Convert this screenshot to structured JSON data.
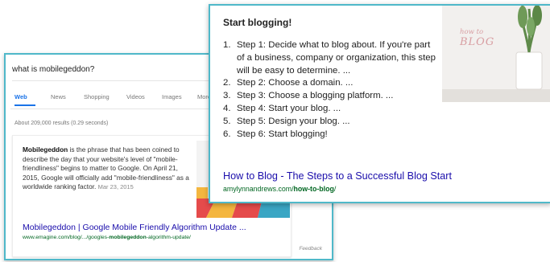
{
  "search_result": {
    "query": "what is mobilegeddon?",
    "tabs": [
      "Web",
      "News",
      "Shopping",
      "Videos",
      "Images",
      "More"
    ],
    "results_stats": "About 209,000 results (0.29 seconds)",
    "snippet": {
      "term": "Mobilegeddon",
      "text": " is the phrase that has been coined to describe the day that your website's level of \"mobile-friendliness\" begins to matter to Google. On April 21, 2015, Google will officially add \"mobile-friendliness\" as a worldwide ranking factor.",
      "date": "Mar 23, 2015",
      "title": "Mobilegeddon | Google Mobile Friendly Algorithm Update ...",
      "url_prefix": "www.emagine.com/blog/.../googles-",
      "url_bold": "mobilegeddon",
      "url_suffix": "-algorithm-update/"
    },
    "feedback": "Feedback"
  },
  "featured_snippet": {
    "title": "Start blogging!",
    "steps": [
      "Step 1: Decide what to blog about. If you're part of a business, company or organization, this step will be easy to determine. ...",
      "Step 2: Choose a domain. ...",
      "Step 3: Choose a blogging platform. ...",
      "Step 4: Start your blog. ...",
      "Step 5: Design your blog. ...",
      "Step 6: Start blogging!"
    ],
    "link_title": "How to Blog - The Steps to a Successful Blog Start",
    "url_prefix": "amylynnandrews.com/",
    "url_bold": "how-to-blog",
    "url_suffix": "/",
    "image_text_small": "how to",
    "image_text_big": "BLOG"
  }
}
